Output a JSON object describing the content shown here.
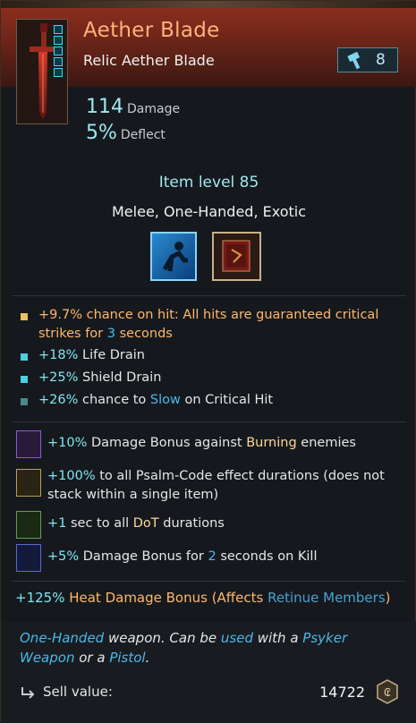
{
  "item": {
    "name": "Aether Blade",
    "subtitle": "Relic Aether Blade",
    "rarity_count": "8",
    "icon": "sword-icon",
    "slot_icons": [
      "slot-icon",
      "slot-icon",
      "slot-icon",
      "slot-icon",
      "slot-icon"
    ]
  },
  "stats": [
    {
      "value": "114",
      "label": "Damage"
    },
    {
      "value": "5%",
      "label": "Deflect"
    }
  ],
  "item_level": "Item level 85",
  "types": "Melee, One-Handed, Exotic",
  "abilities": [
    "dash-ability-icon",
    "tome-ability-icon"
  ],
  "properties": [
    {
      "pre": "+9.7%",
      "mid": " chance on hit: All hits are guaranteed critical strikes for ",
      "num": "3",
      "post": " seconds",
      "color": "#ffb86a"
    },
    {
      "pre": "+18%",
      "mid": " Life Drain",
      "color": "#7fe6f0"
    },
    {
      "pre": "+25%",
      "mid": " Shield Drain",
      "color": "#7fe6f0"
    },
    {
      "pre": "+26%",
      "mid": " chance to ",
      "kw": "Slow",
      "post": " on Critical Hit",
      "color": "#5aa6a6"
    }
  ],
  "augments": [
    {
      "pre": "+10%",
      "mid": " Damage Bonus against ",
      "kw": "Burning",
      "post": " enemies",
      "color": "#8a5ad0"
    },
    {
      "pre": "+100%",
      "mid": " to all Psalm-Code effect durations (does not stack within a single item)",
      "color": "#b8a050"
    },
    {
      "pre": "+1",
      "mid": " sec to all ",
      "kw": "DoT",
      "post": " durations",
      "color": "#6a9a4a"
    },
    {
      "pre": "+5%",
      "mid": " Damage Bonus for ",
      "num": "2",
      "post": " seconds on Kill",
      "color": "#5a6ad0"
    }
  ],
  "heat": {
    "pre": "+125%",
    "mid": " Heat Damage Bonus (Affects ",
    "kw": "Retinue Members",
    "post": ")"
  },
  "description": {
    "t1": "One-Handed",
    "t2": " weapon. Can be ",
    "t3": "used",
    "t4": " with a ",
    "t5": "Psyker Weapon",
    "t6": " or a ",
    "t7": "Pistol",
    "t8": "."
  },
  "sell": {
    "label": "Sell value:",
    "value": "14722",
    "icon": "credits-icon"
  }
}
